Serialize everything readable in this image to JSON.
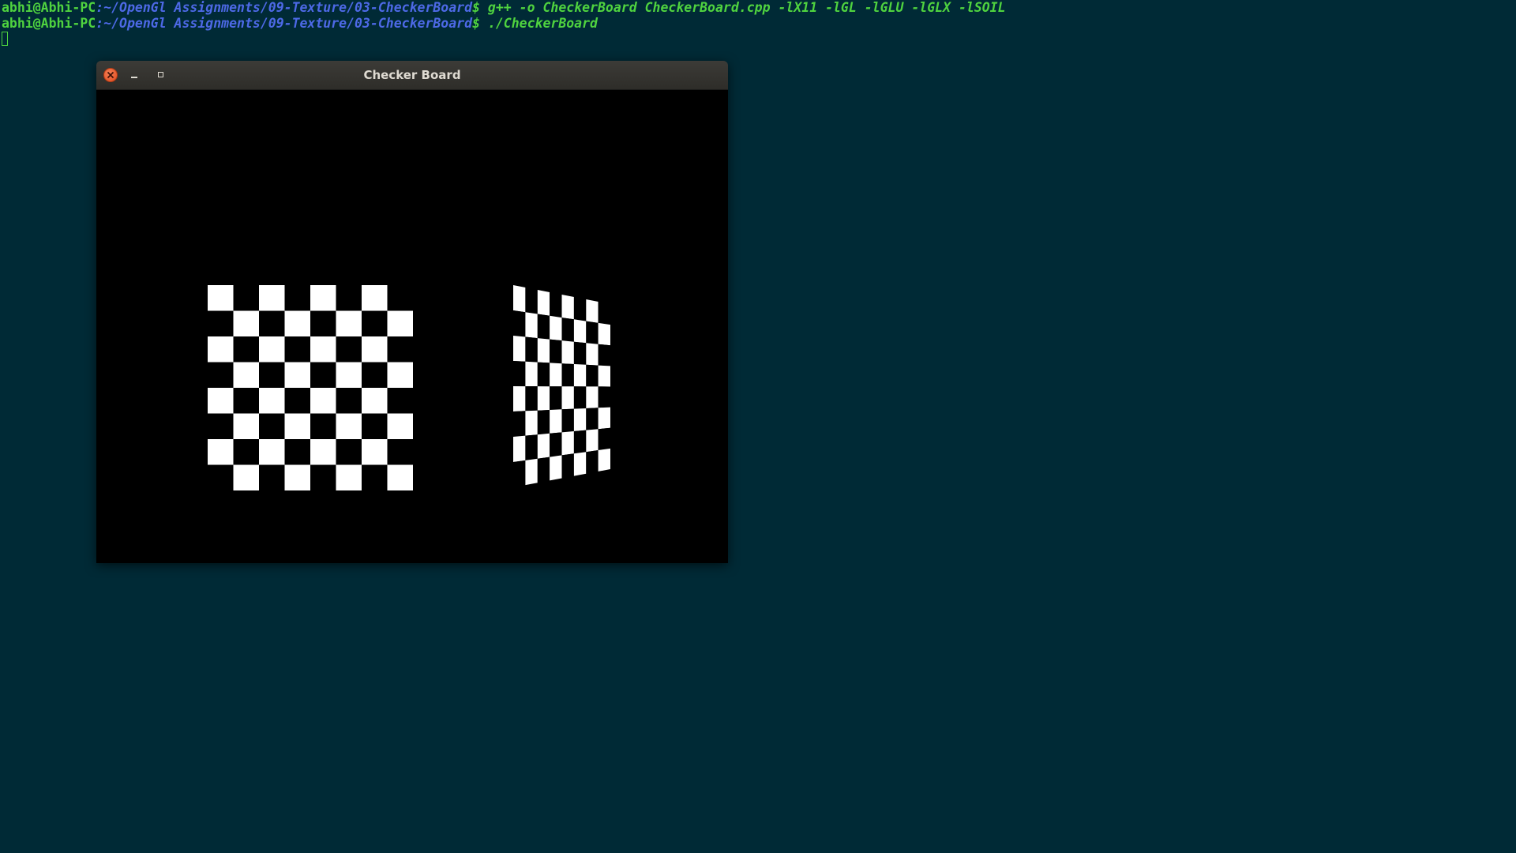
{
  "terminal": {
    "lines": [
      {
        "user": "abhi@Abhi-PC",
        "path": ":~/OpenGl Assignments/09-Texture/03-CheckerBoard",
        "command": "$ g++ -o CheckerBoard CheckerBoard.cpp -lX11 -lGL -lGLU -lGLX -lSOIL"
      },
      {
        "user": "abhi@Abhi-PC",
        "path": ":~/OpenGl Assignments/09-Texture/03-CheckerBoard",
        "command": "$ ./CheckerBoard"
      }
    ]
  },
  "window": {
    "title": "Checker Board",
    "buttons": [
      "close-icon",
      "minimize-icon",
      "maximize-icon"
    ]
  },
  "scene": {
    "left_board": {
      "rows": 8,
      "cols": 8,
      "view": "front-facing"
    },
    "right_board": {
      "rows": 8,
      "cols": 8,
      "view": "rotated-perspective"
    }
  },
  "colors": {
    "desktop_bg": "#002a36",
    "prompt_user": "#4fd33f",
    "prompt_path": "#4d69e6",
    "checker_light": "#ffffff",
    "checker_dark": "#000000"
  }
}
